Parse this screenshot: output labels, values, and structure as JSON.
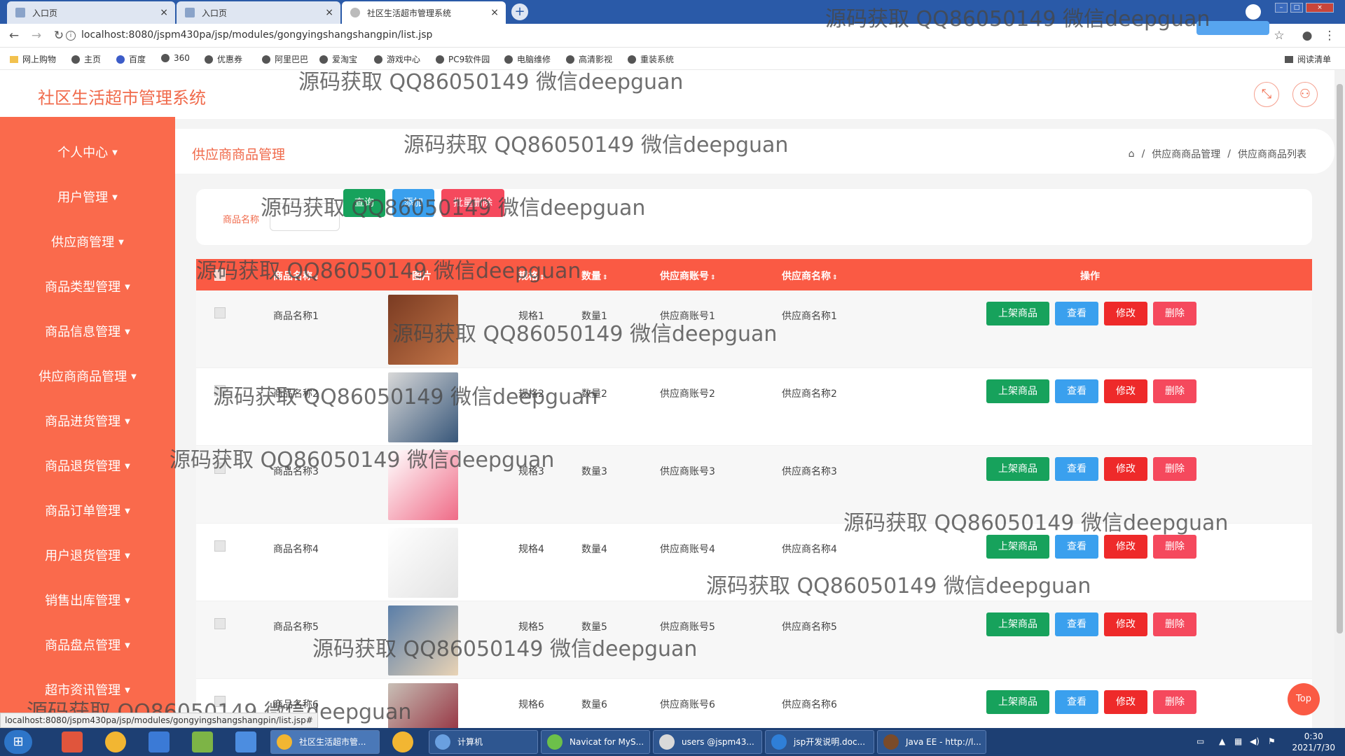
{
  "browser": {
    "tabs": [
      {
        "label": "入口页"
      },
      {
        "label": "入口页"
      },
      {
        "label": "社区生活超市管理系统"
      }
    ],
    "url": "localhost:8080/jspm430pa/jsp/modules/gongyingshangshangpin/list.jsp",
    "bookmarks": [
      "网上购物",
      "主页",
      "百度",
      "360",
      "优惠券",
      "阿里巴巴",
      "爱淘宝",
      "游戏中心",
      "PC9软件园",
      "电脑维修",
      "高清影视",
      "重装系统"
    ],
    "reading_list": "阅读清单",
    "status_url": "localhost:8080/jspm430pa/jsp/modules/gongyingshangshangpin/list.jsp#"
  },
  "app": {
    "title": "社区生活超市管理系统"
  },
  "sidebar": {
    "items": [
      {
        "label": "个人中心"
      },
      {
        "label": "用户管理"
      },
      {
        "label": "供应商管理"
      },
      {
        "label": "商品类型管理"
      },
      {
        "label": "商品信息管理"
      },
      {
        "label": "供应商商品管理"
      },
      {
        "label": "商品进货管理"
      },
      {
        "label": "商品退货管理"
      },
      {
        "label": "商品订单管理"
      },
      {
        "label": "用户退货管理"
      },
      {
        "label": "销售出库管理"
      },
      {
        "label": "商品盘点管理"
      },
      {
        "label": "超市资讯管理"
      }
    ]
  },
  "page": {
    "title": "供应商商品管理",
    "breadcrumb": [
      "供应商商品管理",
      "供应商商品列表"
    ]
  },
  "search": {
    "label": "商品名称",
    "value": "",
    "query_btn": "查询",
    "add_btn": "添加",
    "batch_delete_btn": "批量删除"
  },
  "table": {
    "columns": [
      "商品名称",
      "图片",
      "规格",
      "数量",
      "供应商账号",
      "供应商名称",
      "操作"
    ],
    "rows": [
      {
        "name": "商品名称1",
        "spec": "规格1",
        "qty": "数量1",
        "account": "供应商账号1",
        "supplier": "供应商名称1"
      },
      {
        "name": "商品名称2",
        "spec": "规格2",
        "qty": "数量2",
        "account": "供应商账号2",
        "supplier": "供应商名称2"
      },
      {
        "name": "商品名称3",
        "spec": "规格3",
        "qty": "数量3",
        "account": "供应商账号3",
        "supplier": "供应商名称3"
      },
      {
        "name": "商品名称4",
        "spec": "规格4",
        "qty": "数量4",
        "account": "供应商账号4",
        "supplier": "供应商名称4"
      },
      {
        "name": "商品名称5",
        "spec": "规格5",
        "qty": "数量5",
        "account": "供应商账号5",
        "supplier": "供应商名称5"
      },
      {
        "name": "商品名称6",
        "spec": "规格6",
        "qty": "数量6",
        "account": "供应商账号6",
        "supplier": "供应商名称6"
      }
    ],
    "actions": {
      "shelve": "上架商品",
      "view": "查看",
      "edit": "修改",
      "delete": "删除"
    }
  },
  "watermark": "源码获取 QQ86050149 微信deepguan",
  "top_button": "Top",
  "taskbar": {
    "tasks": [
      {
        "label": "社区生活超市管..."
      },
      {
        "label": "计算机"
      },
      {
        "label": "Navicat for MyS..."
      },
      {
        "label": "users @jspm43..."
      },
      {
        "label": "jsp开发说明.doc..."
      },
      {
        "label": "Java EE - http://l..."
      }
    ],
    "time": "0:30",
    "date": "2021/7/30"
  },
  "colors": {
    "primary": "#fa6a4c",
    "table_header": "#fa5a44",
    "green": "#17a25c",
    "blue": "#3aa0ee",
    "red": "#f5495d",
    "edit_red": "#ee2a2a"
  }
}
